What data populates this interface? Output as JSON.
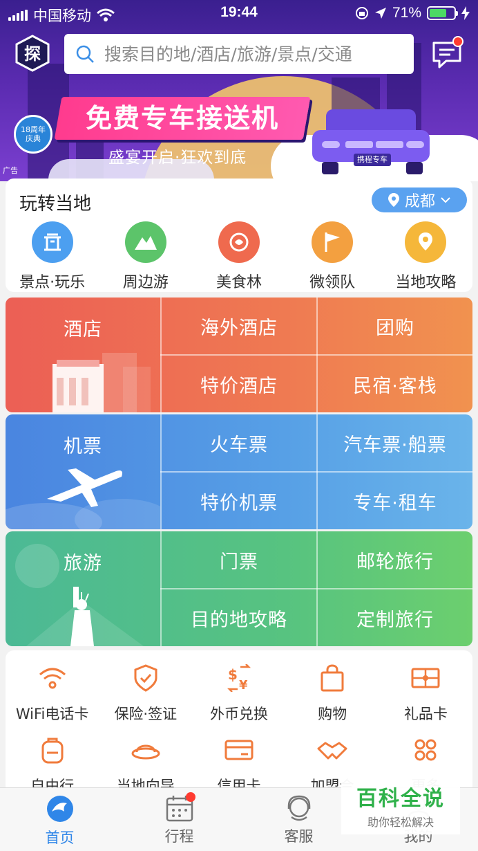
{
  "status_bar": {
    "carrier": "中国移动",
    "time": "19:44",
    "battery": "71%"
  },
  "search": {
    "placeholder": "搜索目的地/酒店/旅游/景点/交通"
  },
  "banner": {
    "title": "免费专车接送机",
    "subtitle": "盛宴开启·狂欢到底",
    "anniversary_line1": "18周年",
    "anniversary_line2": "庆典",
    "ad_tag": "广告",
    "car_label": "携程专车"
  },
  "local": {
    "title": "玩转当地",
    "city": "成都",
    "items": [
      {
        "label": "景点·玩乐",
        "icon": "attraction-icon"
      },
      {
        "label": "周边游",
        "icon": "mountain-icon"
      },
      {
        "label": "美食林",
        "icon": "food-icon"
      },
      {
        "label": "微领队",
        "icon": "flag-icon"
      },
      {
        "label": "当地攻略",
        "icon": "map-pin-icon"
      }
    ]
  },
  "grid": {
    "hotel": {
      "main": "酒店",
      "cells": [
        "海外酒店",
        "团购",
        "特价酒店",
        "民宿·客栈"
      ]
    },
    "flight": {
      "main": "机票",
      "cells": [
        "火车票",
        "汽车票·船票",
        "特价机票",
        "专车·租车"
      ]
    },
    "travel": {
      "main": "旅游",
      "cells": [
        "门票",
        "邮轮旅行",
        "目的地攻略",
        "定制旅行"
      ]
    }
  },
  "tools": {
    "row1": [
      {
        "label": "WiFi电话卡",
        "icon": "wifi-icon"
      },
      {
        "label": "保险·签证",
        "icon": "shield-icon"
      },
      {
        "label": "外币兑换",
        "icon": "currency-exchange-icon"
      },
      {
        "label": "购物",
        "icon": "shopping-bag-icon"
      },
      {
        "label": "礼品卡",
        "icon": "gift-card-icon"
      }
    ],
    "row2": [
      {
        "label": "自由行",
        "icon": "backpack-icon"
      },
      {
        "label": "当地向导",
        "icon": "guide-hat-icon"
      },
      {
        "label": "信用卡",
        "icon": "credit-card-icon"
      },
      {
        "label": "加盟合",
        "icon": "handshake-icon"
      },
      {
        "label": "更多",
        "icon": "more-icon"
      }
    ]
  },
  "tabs": [
    {
      "label": "首页",
      "icon": "home-dolphin-icon",
      "active": true
    },
    {
      "label": "行程",
      "icon": "calendar-icon",
      "active": false
    },
    {
      "label": "客服",
      "icon": "customer-service-icon",
      "active": false
    },
    {
      "label": "我的",
      "icon": "profile-icon",
      "active": false
    }
  ],
  "watermark": {
    "line1": "百科全说",
    "line2": "助你轻松解决"
  },
  "colors": {
    "hotel": "#ec6a55",
    "flight": "#4d8fe0",
    "travel": "#4fbf8c",
    "accent": "#2f86e8",
    "icon_orange": "#f07b3c"
  }
}
